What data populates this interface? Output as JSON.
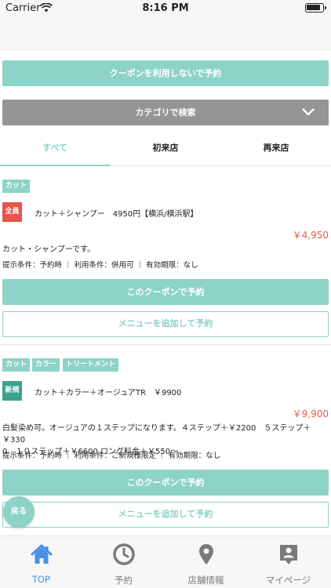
{
  "status_bar": {
    "carrier": "Carrier",
    "time": "8:16 PM"
  },
  "no_coupon_button": "クーポンを利用しないで予約",
  "category_search": "カテゴリで検索",
  "tabs": [
    "すべて",
    "初来店",
    "再来店"
  ],
  "coupons": [
    {
      "tags": [
        "カット"
      ],
      "badge": "全員",
      "title": "カット＋シャンプー　4950円【横浜/横浜駅】",
      "price": "￥4,950",
      "description_lines": [
        "カット・シャンプーです。"
      ],
      "conditions": "提示条件：予約時 ｜ 利用条件：併用可 ｜ 有効期限：なし",
      "use_button": "このクーポンで予約",
      "add_menu_button": "メニューを追加して予約"
    },
    {
      "tags": [
        "カット",
        "カラー",
        "トリートメント"
      ],
      "badge": "新規",
      "title": "カット＋カラー＋オージュアTR　￥9900",
      "price": "￥9,900",
      "description_lines": [
        "白髪染め可。オージュアの１ステップになります。４ステップ＋￥2200　５ステップ＋￥330",
        "0　１０ステップ＋￥6600 ロング料金＋￥550〜"
      ],
      "conditions": "提示条件：予約時 ｜ 利用条件：ご新規様限定 ｜ 有効期限：なし",
      "use_button": "このクーポンで予約",
      "add_menu_button": "メニューを追加して予約"
    }
  ],
  "back_button": "戻る",
  "bottom_tabs": [
    {
      "label": "TOP",
      "icon": "home-icon",
      "active": true
    },
    {
      "label": "予約",
      "icon": "clock-icon",
      "active": false
    },
    {
      "label": "店舗情報",
      "icon": "map-pin-icon",
      "active": false
    },
    {
      "label": "マイページ",
      "icon": "person-badge-icon",
      "active": false
    }
  ],
  "colors": {
    "accent": "#8dd3c8",
    "price": "#e9574a",
    "badge_all": "#e95448",
    "badge_new": "#3ba38e",
    "tab_active": "#4a8fe7",
    "category_bar": "#959595"
  }
}
